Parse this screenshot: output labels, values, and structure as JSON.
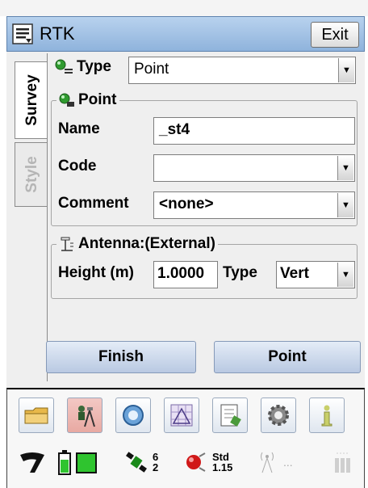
{
  "window": {
    "title": "RTK",
    "exit_label": "Exit"
  },
  "tabs": [
    {
      "label": "Survey",
      "active": true
    },
    {
      "label": "Style",
      "active": false
    }
  ],
  "form": {
    "type_label": "Type",
    "type_value": "Point",
    "point_group_label": "Point",
    "name_label": "Name",
    "name_value": "_st4",
    "code_label": "Code",
    "code_value": "",
    "comment_label": "Comment",
    "comment_value": "<none>",
    "antenna_group_label": "Antenna:(External)",
    "height_label": "Height (m)",
    "height_value": "1.0000",
    "antenna_type_label": "Type",
    "antenna_type_value": "Vert"
  },
  "buttons": {
    "finish_label": "Finish",
    "point_label": "Point"
  },
  "toolbar": {
    "icons": [
      "folder-icon",
      "surveyor-tripod-icon",
      "magnifier-icon",
      "map-grid-icon",
      "notebook-icon",
      "gear-icon",
      "info-icon"
    ]
  },
  "status": {
    "satellites_top": "6",
    "satellites_bottom": "2",
    "precision_mode": "Std",
    "precision_value": "1.15",
    "radio_text": "..."
  }
}
